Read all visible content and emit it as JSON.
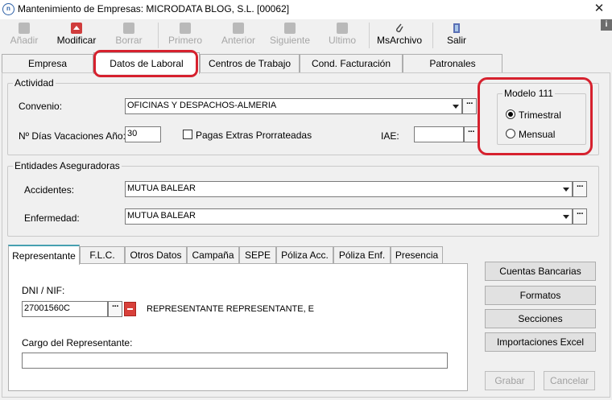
{
  "window": {
    "title": "Mantenimiento de Empresas: MICRODATA BLOG, S.L. [00062]",
    "app_icon": "n",
    "close": "✕"
  },
  "toolbar": {
    "add": "Añadir",
    "modify": "Modificar",
    "delete": "Borrar",
    "first": "Primero",
    "previous": "Anterior",
    "next": "Siguiente",
    "last": "Ultimo",
    "archive": "MsArchivo",
    "exit": "Salir",
    "info": "i"
  },
  "tabs": [
    "Empresa",
    "Datos de Laboral",
    "Centros de Trabajo",
    "Cond. Facturación",
    "Patronales"
  ],
  "actividad": {
    "title": "Actividad",
    "convenio_label": "Convenio:",
    "convenio_value": "OFICINAS Y DESPACHOS-ALMERIA",
    "vacaciones_label": "Nº Días Vacaciones Año:",
    "vacaciones_value": "30",
    "pagas_label": "Pagas Extras Prorrateadas",
    "iae_label": "IAE:",
    "iae_value": ""
  },
  "modelo111": {
    "title": "Modelo 111",
    "trimestral": "Trimestral",
    "mensual": "Mensual",
    "selected": "Trimestral"
  },
  "entidades": {
    "title": "Entidades Aseguradoras",
    "accidentes_label": "Accidentes:",
    "accidentes_value": "MUTUA BALEAR",
    "enfermedad_label": "Enfermedad:",
    "enfermedad_value": "MUTUA BALEAR"
  },
  "subtabs": [
    "Representante",
    "F.L.C.",
    "Otros Datos",
    "Campaña",
    "SEPE",
    "Póliza Acc.",
    "Póliza Enf.",
    "Presencia"
  ],
  "representante": {
    "dni_label": "DNI / NIF:",
    "dni_value": "27001560C",
    "name": "REPRESENTANTE REPRESENTANTE, E",
    "cargo_label": "Cargo del Representante:",
    "cargo_value": ""
  },
  "side_buttons": {
    "cuentas": "Cuentas Bancarias",
    "formatos": "Formatos",
    "secciones": "Secciones",
    "importaciones": "Importaciones Excel"
  },
  "footer": {
    "grabar": "Grabar",
    "cancelar": "Cancelar"
  },
  "dots": "···"
}
